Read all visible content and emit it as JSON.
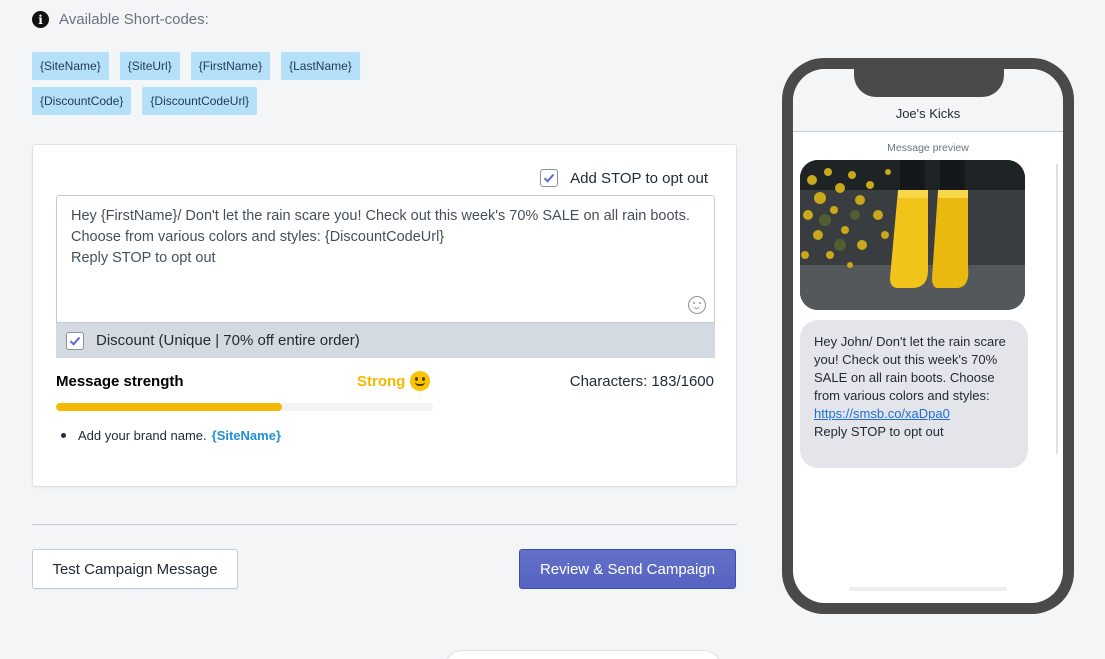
{
  "shortcodes": {
    "title": "Available Short-codes:",
    "row1": [
      "{SiteName}",
      "{SiteUrl}",
      "{FirstName}",
      "{LastName}"
    ],
    "row2": [
      "{DiscountCode}",
      "{DiscountCodeUrl}"
    ]
  },
  "editor": {
    "optout_label": "Add STOP to opt out",
    "optout_checked": true,
    "message": "Hey {FirstName}/ Don't let the rain scare you! Check out this week's 70% SALE on all rain boots. Choose from various colors and styles: {DiscountCodeUrl}\nReply STOP to opt out",
    "discount_label": "Discount (Unique | 70% off entire order)",
    "discount_checked": true,
    "strength_label": "Message strength",
    "strength_value": "Strong",
    "strength_fraction": 0.6,
    "characters": "Characters: 183/1600",
    "tip_text": "Add your brand name.",
    "tip_code": "{SiteName}"
  },
  "actions": {
    "test_label": "Test Campaign Message",
    "send_label": "Review & Send Campaign"
  },
  "preview": {
    "contact_name": "Joe's Kicks",
    "label": "Message preview",
    "image": "yellow-rain-boots-photo",
    "bubble_text": "Hey John/ Don't let the rain scare you! Check out this week's 70% SALE on all rain boots. Choose from various colors and styles:",
    "link": "https://smsb.co/xaDpa0",
    "bubble_footer": "Reply STOP to opt out"
  },
  "colors": {
    "accent": "#5c6ac4",
    "strength": "#f5b800",
    "chip": "#b4e0fa"
  }
}
